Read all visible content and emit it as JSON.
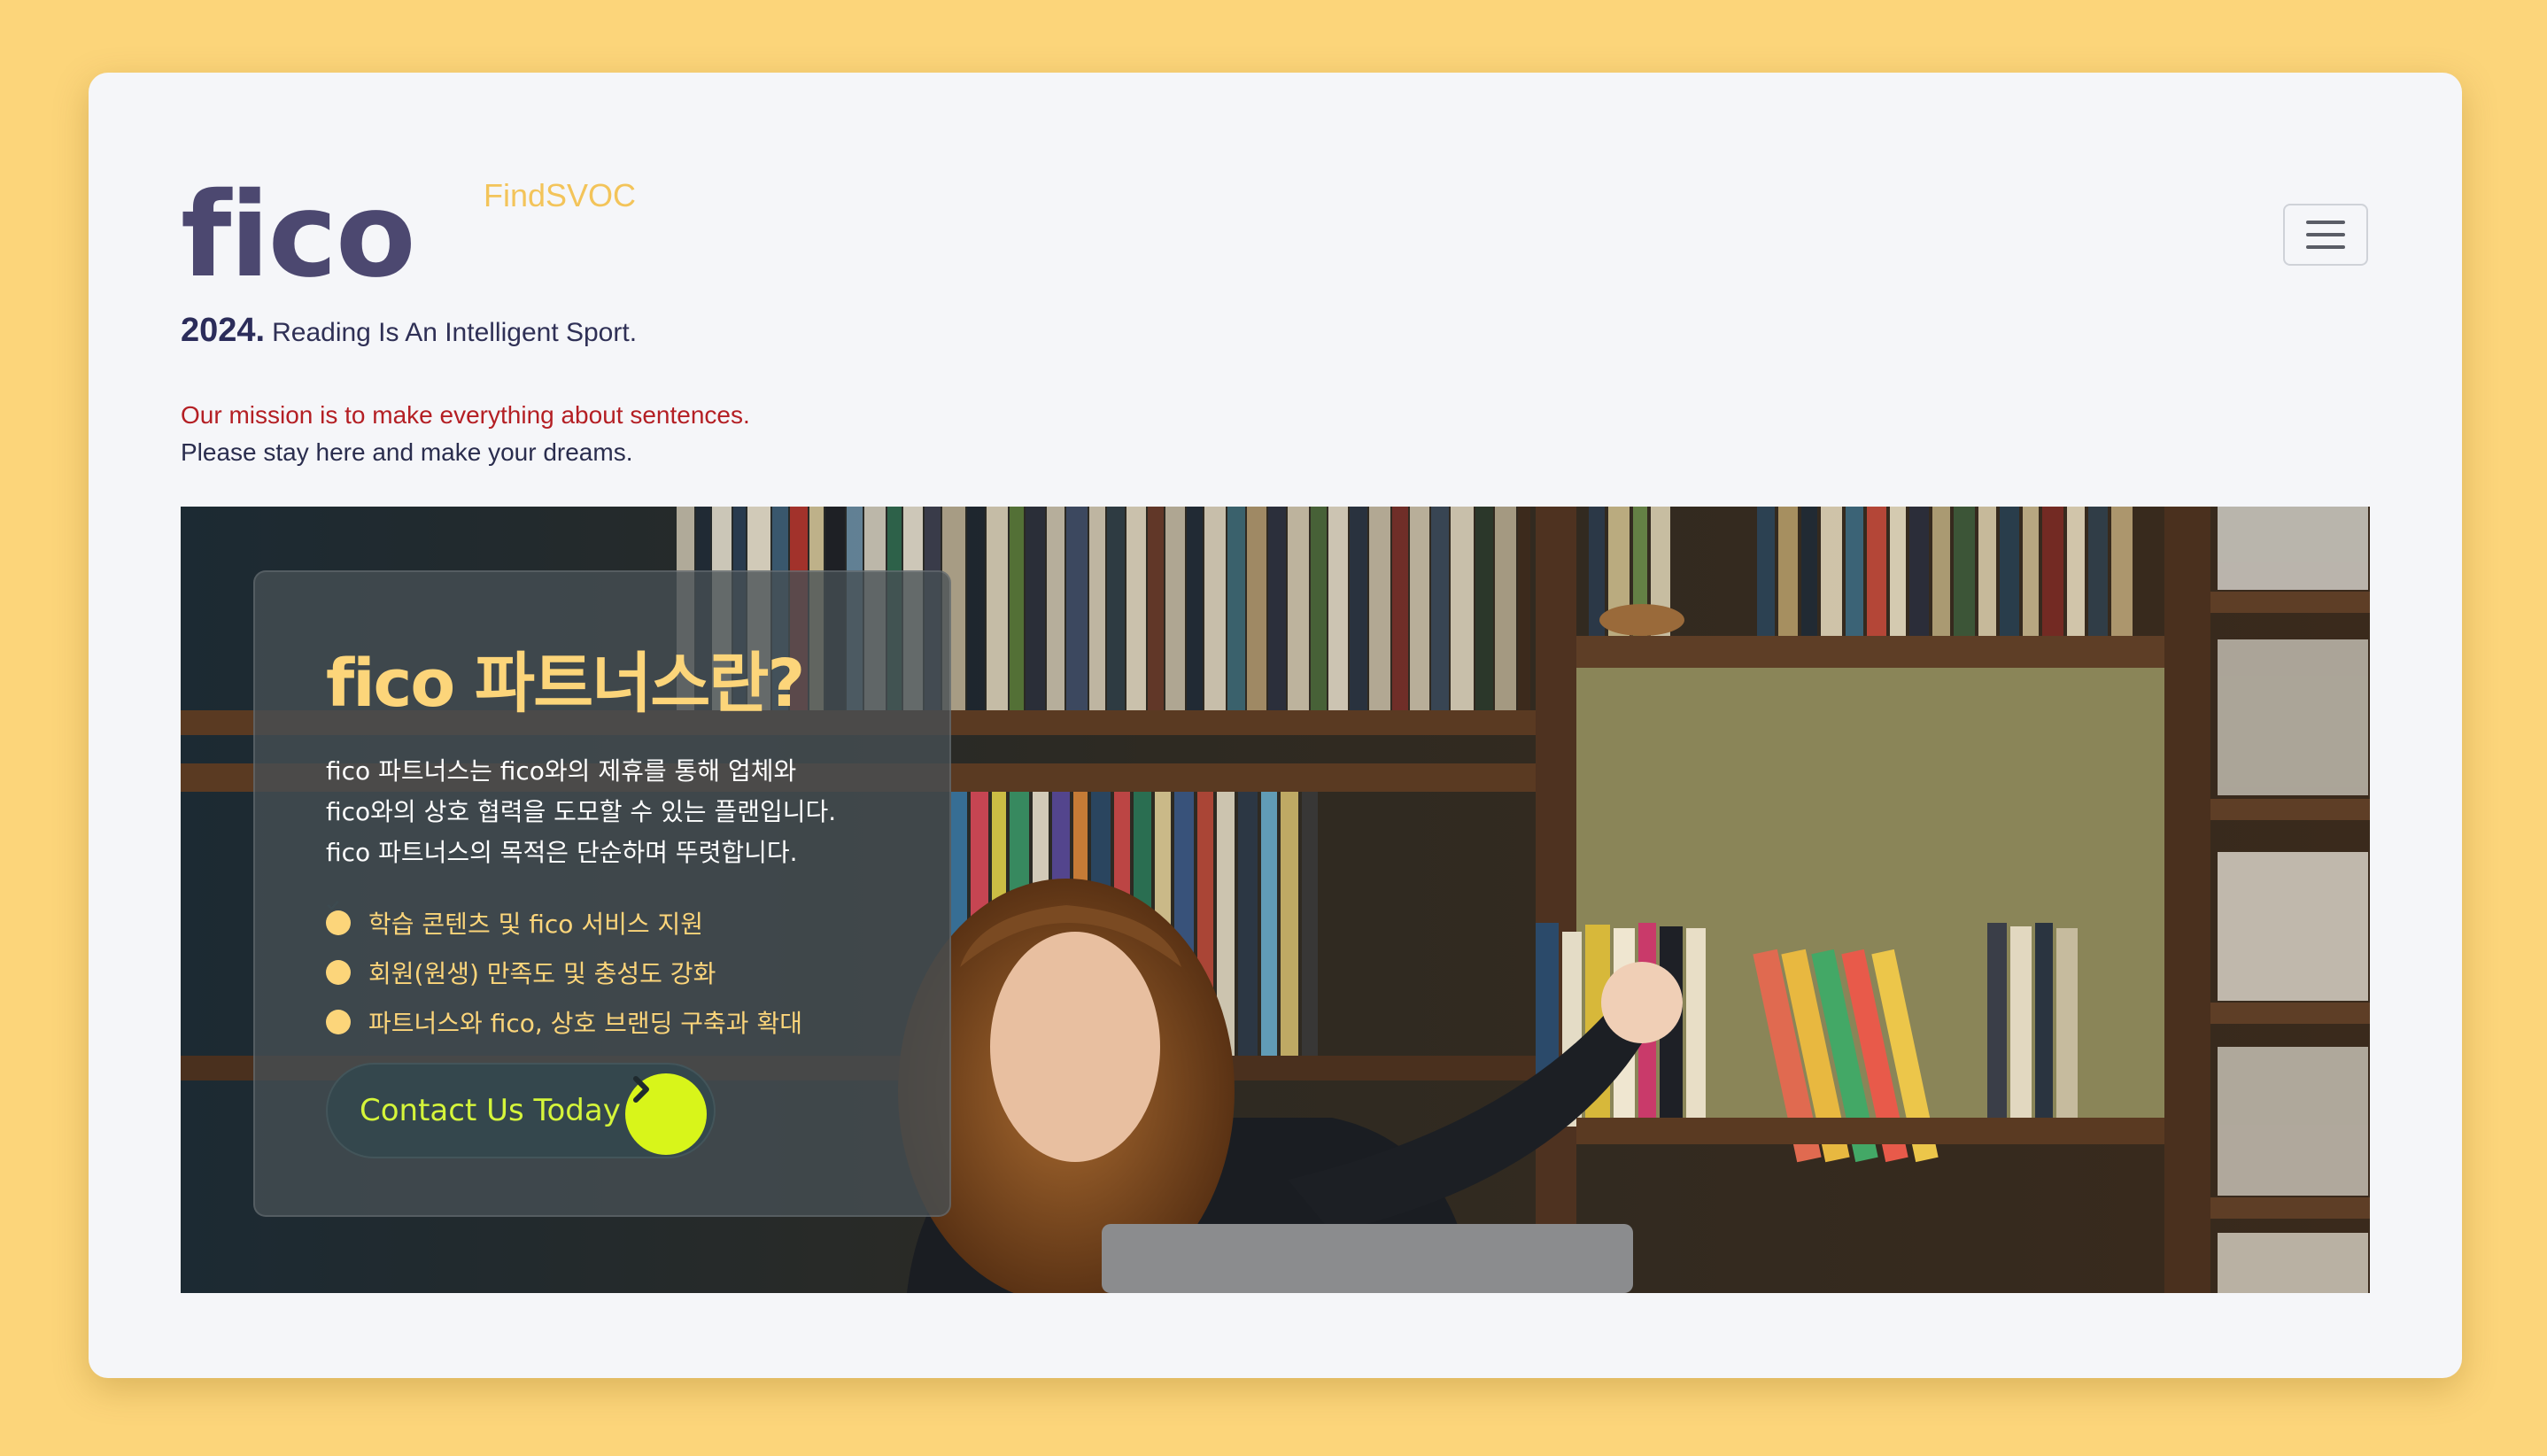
{
  "brand": {
    "logo_text": "fico",
    "logo_subtitle": "FindSVOC"
  },
  "header": {
    "menu_icon": "hamburger-icon"
  },
  "tagline": {
    "year": "2024.",
    "text": "Reading Is An Intelligent Sport."
  },
  "mission": {
    "line1": "Our mission is to make everything about sentences.",
    "line2": "Please stay here and make your dreams."
  },
  "hero": {
    "title": "fico 파트너스란?",
    "description": [
      "fico 파트너스는 fico와의 제휴를 통해 업체와",
      "fico와의 상호 협력을 도모할 수 있는 플랜입니다.",
      "fico 파트너스의 목적은 단순하며 뚜렷합니다."
    ],
    "features": [
      "학습 콘텐츠 및 fico 서비스 지원",
      "회원(원생) 만족도 및 충성도 강화",
      "파트너스와 fico, 상호 브랜딩 구축과 확대"
    ],
    "cta_label": "Contact Us Today",
    "cta_icon": "chevron-right-icon",
    "check_icon": "check-circle-icon"
  },
  "colors": {
    "page_bg": "#fcd57a",
    "brand_purple": "#4c4870",
    "accent_yellow": "#fcd57a",
    "cta_green": "#d8f51a",
    "mission_red": "#b41f24"
  }
}
